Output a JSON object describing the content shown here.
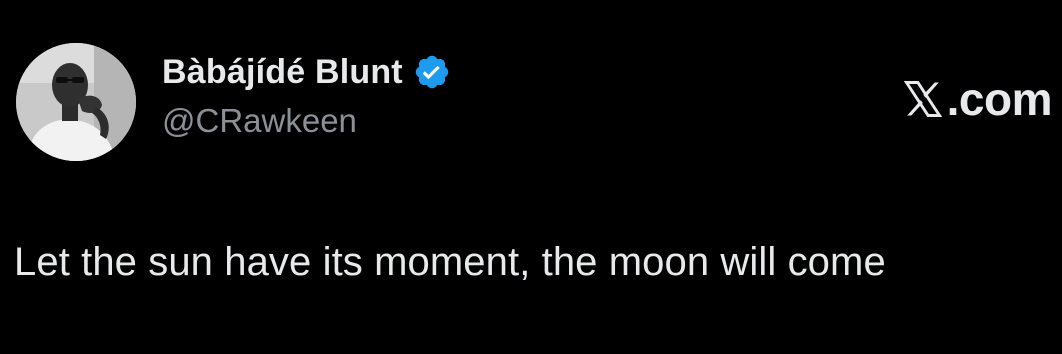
{
  "tweet": {
    "author": {
      "display_name": "Bàbájídé Blunt",
      "handle": "@CRawkeen",
      "verified": true,
      "avatar_icon": "profile-photo"
    },
    "brand": {
      "icon": "x-logo-icon",
      "text": ".com"
    },
    "text": "Let the sun have its moment, the moon will come"
  },
  "colors": {
    "background": "#000000",
    "primary_text": "#e7e9ea",
    "secondary_text": "#8b9096",
    "verified_blue": "#1d9bf0"
  }
}
